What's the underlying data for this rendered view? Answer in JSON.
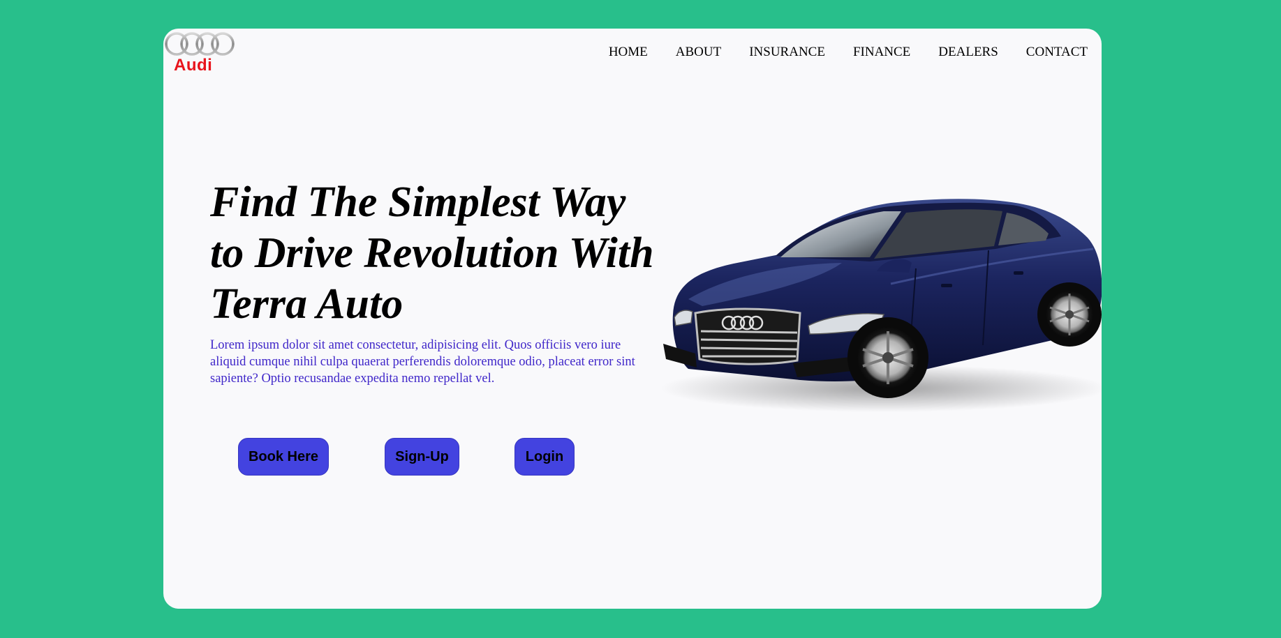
{
  "brand": {
    "name": "Audi",
    "color": "#e8141c"
  },
  "nav": {
    "items": [
      {
        "label": "HOME"
      },
      {
        "label": "ABOUT"
      },
      {
        "label": "INSURANCE"
      },
      {
        "label": "FINANCE"
      },
      {
        "label": "DEALERS"
      },
      {
        "label": "CONTACT"
      }
    ]
  },
  "hero": {
    "headline": "Find The Simplest Way to Drive Revolution With Terra Auto",
    "lede": "Lorem ipsum dolor sit amet consectetur, adipisicing elit. Quos officiis vero iure aliquid cumque nihil culpa quaerat perferendis doloremque odio, placeat error sint sapiente? Optio recusandae expedita nemo repellat vel.",
    "buttons": {
      "book": "Book Here",
      "signup": "Sign-Up",
      "login": "Login"
    },
    "image": "audi-sedan-image"
  },
  "colors": {
    "background": "#28bf8b",
    "card": "#f9f9fb",
    "button": "#4343e0",
    "lede_text": "#3f26c9"
  }
}
